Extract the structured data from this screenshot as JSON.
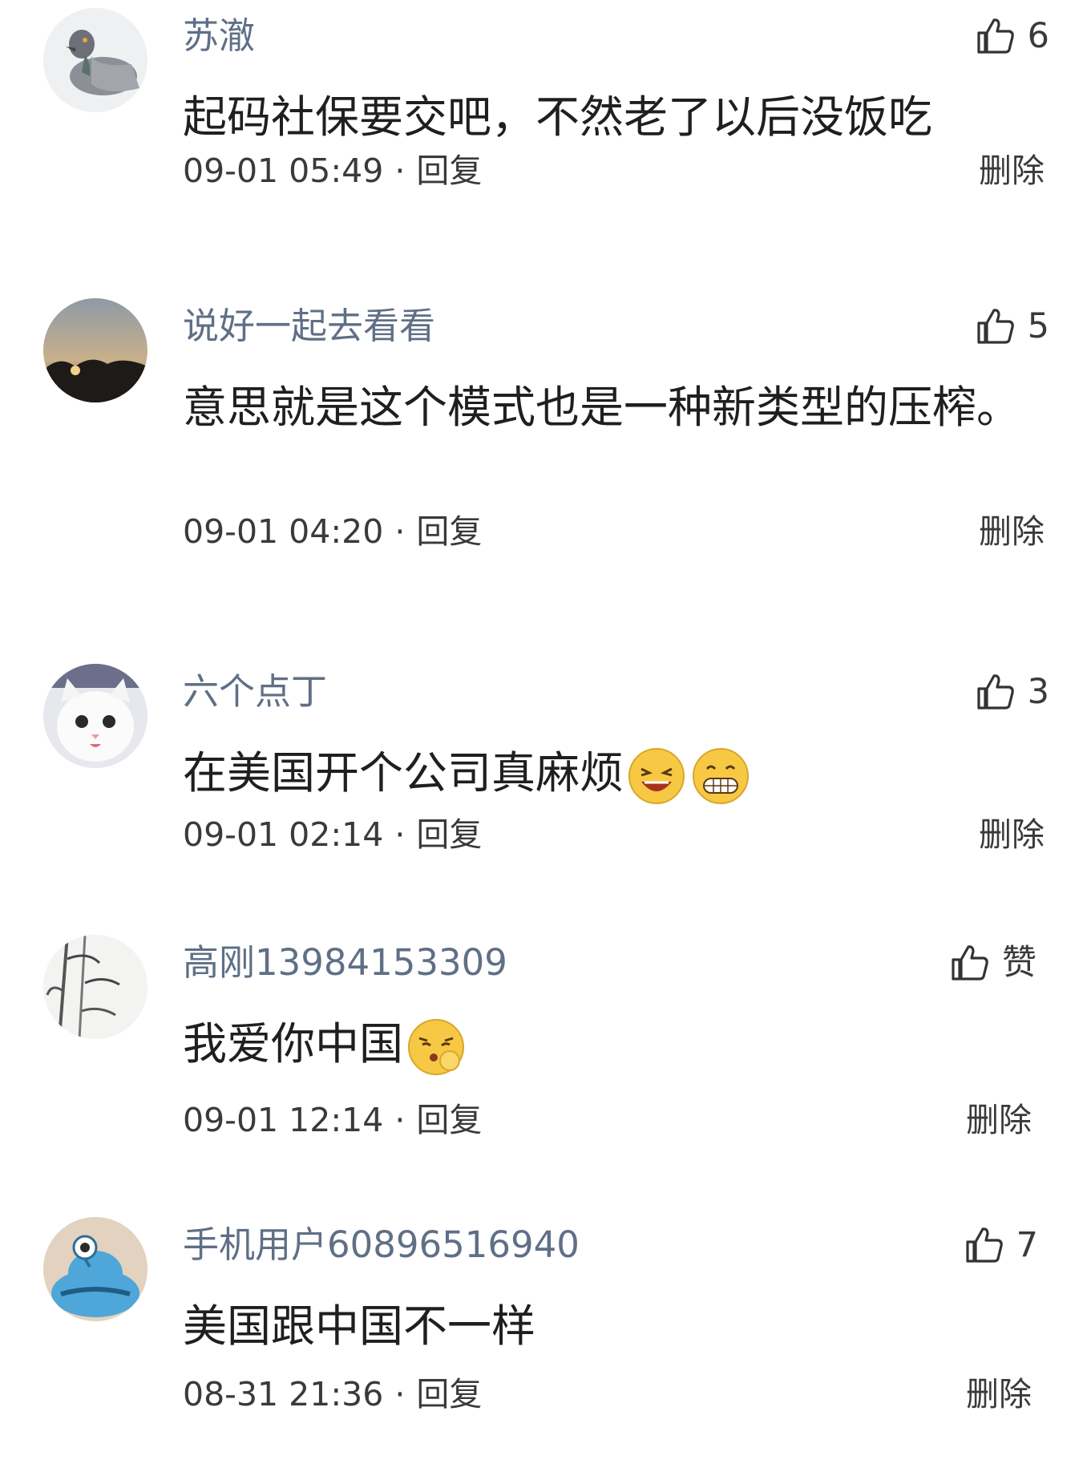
{
  "comments": [
    {
      "username": "苏澈",
      "like_count": "6",
      "text": "起码社保要交吧，不然老了以后没饭吃",
      "time": "09-01 05:49",
      "reply_label": "回复",
      "delete_label": "删除"
    },
    {
      "username": "说好一起去看看",
      "like_count": "5",
      "text": "意思就是这个模式也是一种新类型的压榨。",
      "time": "09-01 04:20",
      "reply_label": "回复",
      "delete_label": "删除"
    },
    {
      "username": "六个点丁",
      "like_count": "3",
      "text": "在美国开个公司真麻烦",
      "time": "09-01 02:14",
      "reply_label": "回复",
      "delete_label": "删除"
    },
    {
      "username": "高刚13984153309",
      "like_count": "赞",
      "text": "我爱你中国",
      "time": "09-01 12:14",
      "reply_label": "回复",
      "delete_label": "删除"
    },
    {
      "username": "手机用户60896516940",
      "like_count": "7",
      "text": "美国跟中国不一样",
      "time": "08-31 21:36",
      "reply_label": "回复",
      "delete_label": "删除"
    }
  ],
  "icons": {
    "like": "thumbs-up-icon",
    "emoji_laugh": "laughing-emoji",
    "emoji_grin": "grinning-emoji",
    "emoji_kiss": "kissing-emoji"
  }
}
